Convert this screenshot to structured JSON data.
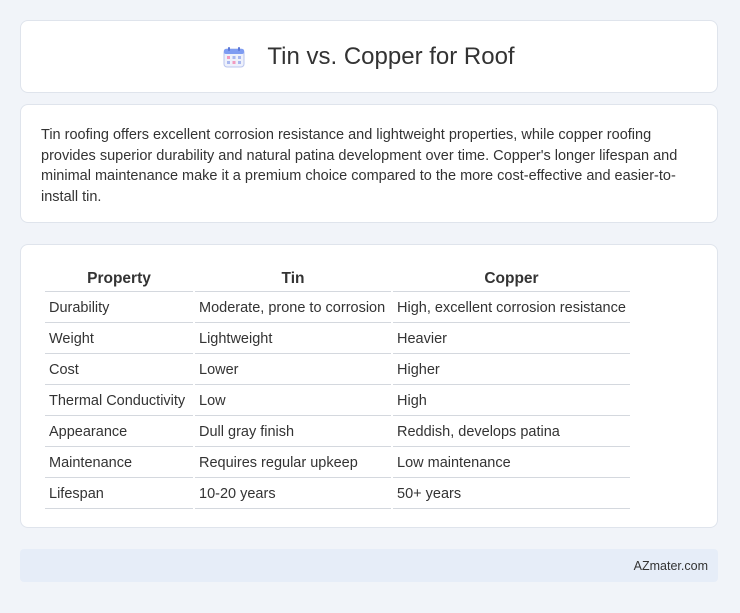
{
  "header": {
    "icon": "calendar-icon",
    "title": "Tin vs. Copper for Roof"
  },
  "description": "Tin roofing offers excellent corrosion resistance and lightweight properties, while copper roofing provides superior durability and natural patina development over time. Copper's longer lifespan and minimal maintenance make it a premium choice compared to the more cost-effective and easier-to-install tin.",
  "table": {
    "headers": [
      "Property",
      "Tin",
      "Copper"
    ],
    "rows": [
      [
        "Durability",
        "Moderate, prone to corrosion",
        "High, excellent corrosion resistance"
      ],
      [
        "Weight",
        "Lightweight",
        "Heavier"
      ],
      [
        "Cost",
        "Lower",
        "Higher"
      ],
      [
        "Thermal Conductivity",
        "Low",
        "High"
      ],
      [
        "Appearance",
        "Dull gray finish",
        "Reddish, develops patina"
      ],
      [
        "Maintenance",
        "Requires regular upkeep",
        "Low maintenance"
      ],
      [
        "Lifespan",
        "10-20 years",
        "50+ years"
      ]
    ]
  },
  "footer": {
    "text": "AZmater.com"
  },
  "colors": {
    "background": "#f1f4f9",
    "card": "#ffffff",
    "footer_bg": "#e6edf8",
    "icon_accent": "#6c8ef5",
    "icon_header": "#f08ab0"
  }
}
